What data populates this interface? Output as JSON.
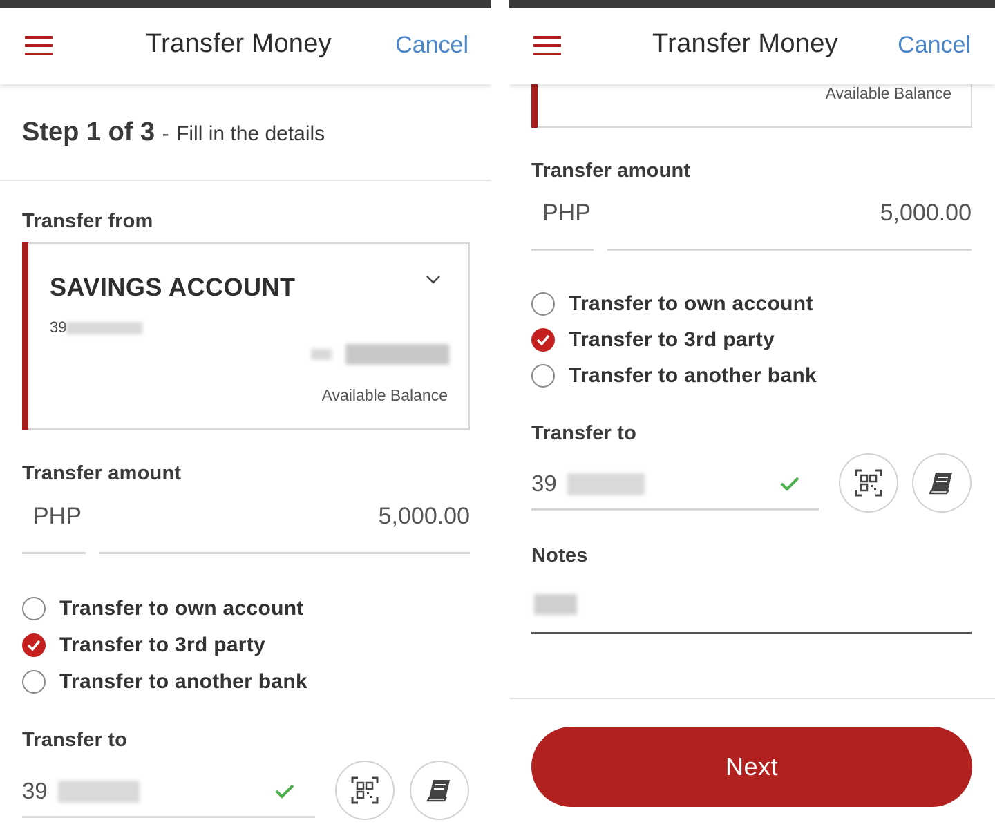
{
  "header": {
    "title": "Transfer Money",
    "cancel_label": "Cancel"
  },
  "step": {
    "main": "Step 1 of 3",
    "separator": "-",
    "subtitle": "Fill in the details"
  },
  "transfer_from": {
    "label": "Transfer from",
    "account_name": "SAVINGS ACCOUNT",
    "account_number_prefix": "39",
    "balance_label": "Available Balance"
  },
  "transfer_amount": {
    "label": "Transfer amount",
    "currency": "PHP",
    "amount": "5,000.00"
  },
  "transfer_types": [
    {
      "label": "Transfer to own account",
      "checked": false
    },
    {
      "label": "Transfer to 3rd party",
      "checked": true
    },
    {
      "label": "Transfer to another bank",
      "checked": false
    }
  ],
  "transfer_to": {
    "label": "Transfer to",
    "account_prefix": "39"
  },
  "notes": {
    "label": "Notes"
  },
  "next_label": "Next",
  "colors": {
    "brand_red": "#b2201f",
    "link_blue": "#4a86c8",
    "success_green": "#4caf50"
  },
  "icons": [
    "menu-icon",
    "chevron-down-icon",
    "checkmark-icon",
    "qr-code-icon",
    "address-book-icon"
  ]
}
